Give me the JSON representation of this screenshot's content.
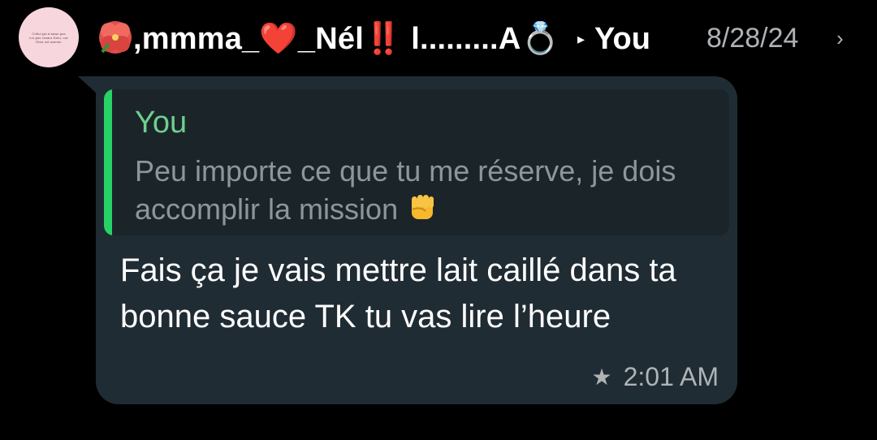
{
  "avatar": {
    "text": "Celui qui n'aime pas n'a pas connu Dieu, car Dieu est amour."
  },
  "header": {
    "sender_name": ",mmma_❤️_Nél‼️ l.........A💍",
    "sender_prefix_icon": "hibiscus-flower-emoji",
    "direction_icon": "right-triangle-arrow",
    "recipient": "You",
    "date": "8/28/24",
    "chevron_icon": "chevron-right-icon"
  },
  "quoted": {
    "author": "You",
    "text": "Peu importe ce que tu me réserve, je dois accomplir la mission"
  },
  "message": {
    "text": "Fais ça je vais mettre lait caillé dans ta bonne sauce TK tu vas lire l’heure",
    "starred": true,
    "time": "2:01 AM"
  },
  "colors": {
    "background": "#000000",
    "bubble": "#202c33",
    "quote_bg": "#1b2529",
    "quote_bar": "#25d366",
    "quote_author": "#6fcf8e",
    "meta": "#aeb3b6"
  }
}
